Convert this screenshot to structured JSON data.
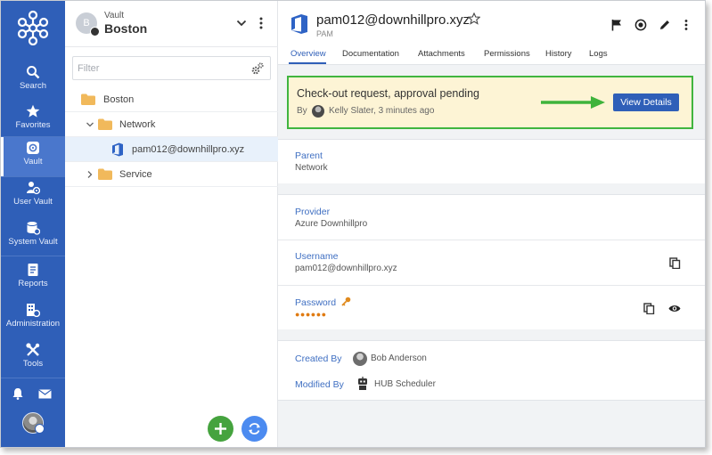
{
  "nav": {
    "items": [
      {
        "label": "Search",
        "icon": "search-icon"
      },
      {
        "label": "Favorites",
        "icon": "star-icon"
      },
      {
        "label": "Vault",
        "icon": "vault-icon"
      },
      {
        "label": "User Vault",
        "icon": "user-vault-icon"
      },
      {
        "label": "System Vault",
        "icon": "system-vault-icon"
      },
      {
        "label": "Reports",
        "icon": "reports-icon"
      },
      {
        "label": "Administration",
        "icon": "administration-icon"
      },
      {
        "label": "Tools",
        "icon": "tools-icon"
      }
    ],
    "active": "Vault",
    "accent": "#2f5fb8"
  },
  "vault": {
    "avatar_letter": "B",
    "subtitle": "Vault",
    "name": "Boston"
  },
  "filter": {
    "placeholder": "Filter"
  },
  "tree": {
    "root": "Boston",
    "network": "Network",
    "entry": "pam012@downhillpro.xyz",
    "service": "Service"
  },
  "detail": {
    "title": "pam012@downhillpro.xyz",
    "subtitle": "PAM",
    "tabs": [
      "Overview",
      "Documentation",
      "Attachments",
      "Permissions",
      "History",
      "Logs"
    ],
    "active_tab": "Overview"
  },
  "banner": {
    "title": "Check-out request, approval pending",
    "by_label": "By",
    "by_detail": "Kelly Slater, 3 minutes ago",
    "button": "View Details",
    "highlight_color": "#40b53f"
  },
  "fields": {
    "parent_label": "Parent",
    "parent_value": "Network",
    "provider_label": "Provider",
    "provider_value": "Azure Downhillpro",
    "username_label": "Username",
    "username_value": "pam012@downhillpro.xyz",
    "password_label": "Password",
    "password_mask": "●●●●●●"
  },
  "meta": {
    "created_label": "Created By",
    "created_value": "Bob Anderson",
    "modified_label": "Modified By",
    "modified_value": "HUB Scheduler"
  }
}
